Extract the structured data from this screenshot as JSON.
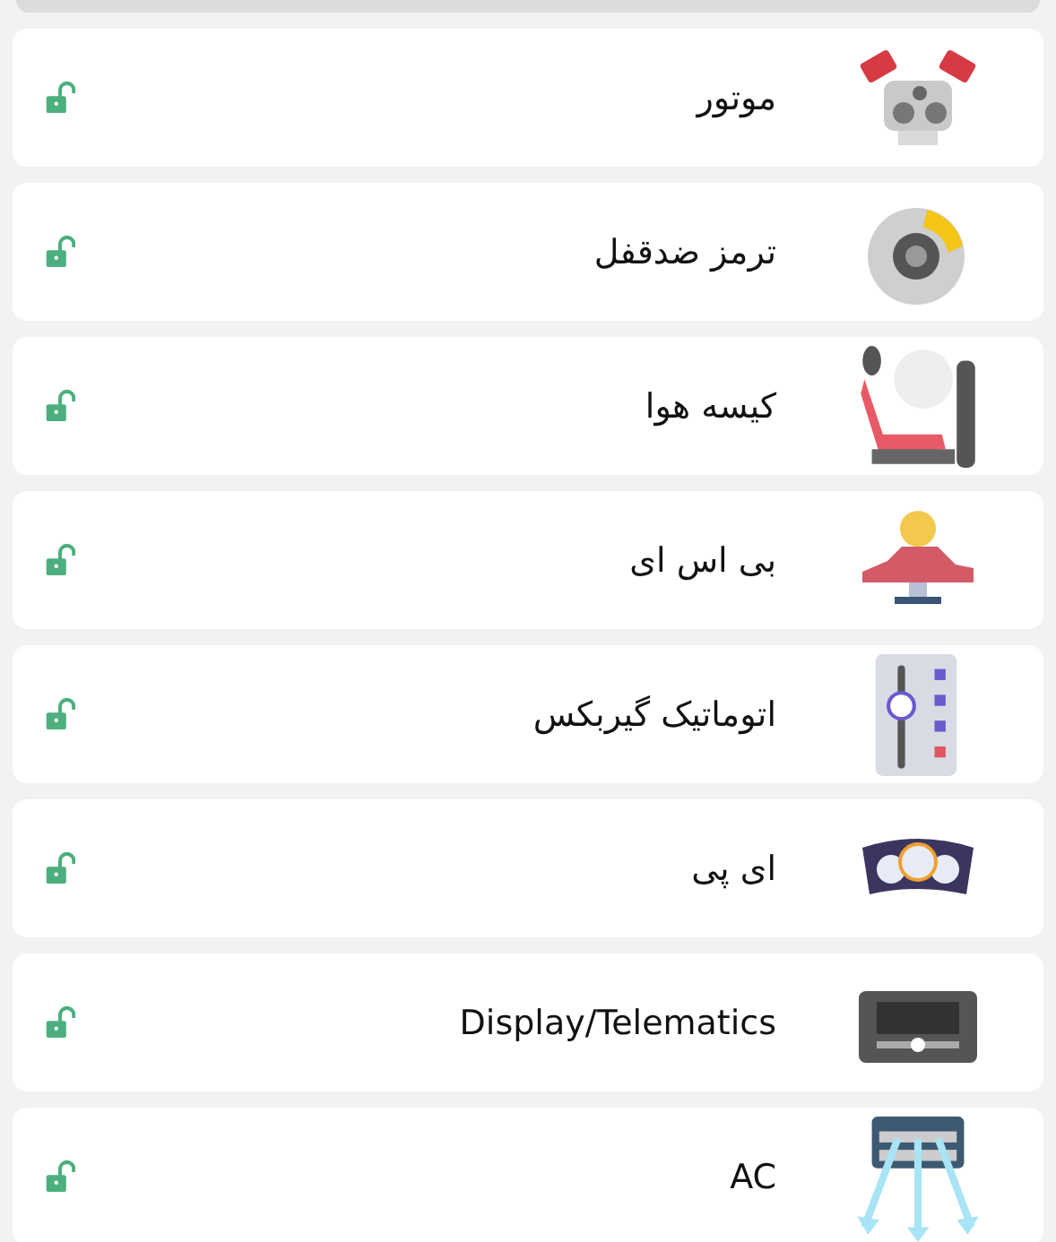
{
  "items": [
    {
      "label": "موتور",
      "locked": false
    },
    {
      "label": "ترمز ضدقفل",
      "locked": false
    },
    {
      "label": "کیسه هوا",
      "locked": false
    },
    {
      "label": "بی اس ای",
      "locked": false
    },
    {
      "label": "اتوماتیک گیربکس",
      "locked": false
    },
    {
      "label": "ای پی",
      "locked": false
    },
    {
      "label": "Display/Telematics",
      "locked": false
    },
    {
      "label": "AC",
      "locked": false
    }
  ]
}
